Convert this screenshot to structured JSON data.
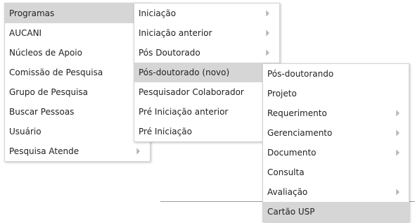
{
  "menu_main": {
    "items": [
      {
        "label": "Programas",
        "has_submenu": false
      },
      {
        "label": "AUCANI",
        "has_submenu": false
      },
      {
        "label": "Núcleos de Apoio",
        "has_submenu": false
      },
      {
        "label": "Comissão de Pesquisa",
        "has_submenu": false
      },
      {
        "label": "Grupo de Pesquisa",
        "has_submenu": false
      },
      {
        "label": "Buscar Pessoas",
        "has_submenu": false
      },
      {
        "label": "Usuário",
        "has_submenu": false
      },
      {
        "label": "Pesquisa Atende",
        "has_submenu": true
      }
    ],
    "active_index": 0
  },
  "menu_programas": {
    "items": [
      {
        "label": "Iniciação",
        "has_submenu": true
      },
      {
        "label": "Iniciação anterior",
        "has_submenu": true
      },
      {
        "label": "Pós Doutorado",
        "has_submenu": true
      },
      {
        "label": "Pós-doutorado (novo)",
        "has_submenu": false
      },
      {
        "label": "Pesquisador Colaborador",
        "has_submenu": false
      },
      {
        "label": "Pré Iniciação anterior",
        "has_submenu": false
      },
      {
        "label": "Pré Iniciação",
        "has_submenu": false
      }
    ],
    "active_index": 3
  },
  "menu_posdoc_novo": {
    "items": [
      {
        "label": "Pós-doutorando",
        "has_submenu": false
      },
      {
        "label": "Projeto",
        "has_submenu": false
      },
      {
        "label": "Requerimento",
        "has_submenu": true
      },
      {
        "label": "Gerenciamento",
        "has_submenu": true
      },
      {
        "label": "Documento",
        "has_submenu": true
      },
      {
        "label": "Consulta",
        "has_submenu": false
      },
      {
        "label": "Avaliação",
        "has_submenu": true
      },
      {
        "label": "Cartão USP",
        "has_submenu": false
      }
    ],
    "active_index": 7
  }
}
